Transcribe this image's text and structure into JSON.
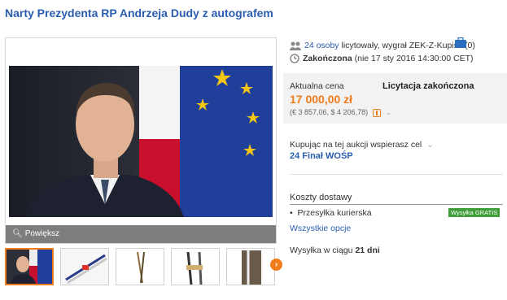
{
  "title": "Narty Prezydenta RP Andrzeja Dudy z autografem",
  "gallery": {
    "zoom_label": "Powiększ",
    "thumbnails": [
      "portrait",
      "skis-1",
      "skis-2",
      "skis-3",
      "skis-4"
    ]
  },
  "bidders": {
    "count_link": "24 osoby",
    "text": "licytowały, wygrał",
    "winner": "ZEK-Z-Kupisz",
    "winner_score": "(0)"
  },
  "status": {
    "label": "Zakończona",
    "detail": "(nie 17 sty 2016 14:30:00 CET)"
  },
  "price": {
    "label": "Aktualna cena",
    "ended": "Licytacja zakończona",
    "value": "17 000,00 zł",
    "conversion": "(€ 3 857,06, $ 4 206,78)"
  },
  "charity": {
    "text": "Kupując na tej aukcji wspierasz cel",
    "link": "24 Finał WOŚP"
  },
  "shipping": {
    "heading": "Koszty dostawy",
    "item": "Przesyłka kurierska",
    "badge": "Wysyłka GRATIS",
    "all_options": "Wszystkie opcje",
    "dispatch_prefix": "Wysyłka w ciągu",
    "dispatch_value": "21 dni"
  },
  "colors": {
    "accent": "#f07c1a",
    "link": "#2a5db0",
    "badge": "#3f9e3a"
  }
}
